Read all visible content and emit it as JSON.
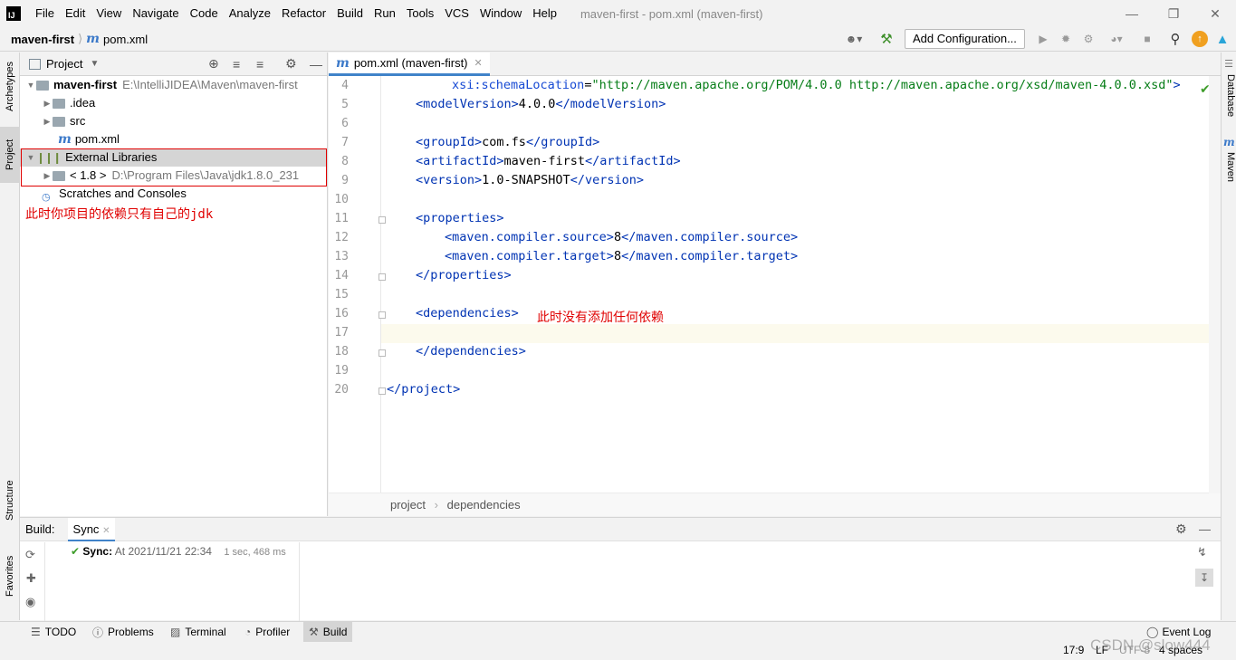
{
  "menubar": {
    "logo": "IJ",
    "items": [
      "File",
      "Edit",
      "View",
      "Navigate",
      "Code",
      "Analyze",
      "Refactor",
      "Build",
      "Run",
      "Tools",
      "VCS",
      "Window",
      "Help"
    ],
    "window_title": "maven-first - pom.xml (maven-first)"
  },
  "navbar": {
    "project": "maven-first",
    "file": "pom.xml",
    "add_configuration": "Add Configuration..."
  },
  "left_stripe": {
    "archetypes": "Archetypes",
    "project": "Project",
    "structure": "Structure",
    "favorites": "Favorites"
  },
  "right_stripe": {
    "database": "Database",
    "maven": "Maven"
  },
  "project_panel": {
    "title": "Project",
    "tree": {
      "root_name": "maven-first",
      "root_path": "E:\\IntelliJIDEA\\Maven\\maven-first",
      "idea": ".idea",
      "src": "src",
      "pom": "pom.xml",
      "ext_libs": "External Libraries",
      "jdk_name": "< 1.8 >",
      "jdk_path": "D:\\Program Files\\Java\\jdk1.8.0_231",
      "scratches": "Scratches and Consoles"
    },
    "annotation": "此时你项目的依赖只有自己的jdk"
  },
  "editor": {
    "tab_label": "pom.xml (maven-first)",
    "lines": {
      "n4": "4",
      "n5": "5",
      "n6": "6",
      "n7": "7",
      "n8": "8",
      "n9": "9",
      "n10": "10",
      "n11": "11",
      "n12": "12",
      "n13": "13",
      "n14": "14",
      "n15": "15",
      "n16": "16",
      "n17": "17",
      "n18": "18",
      "n19": "19",
      "n20": "20"
    },
    "code": {
      "l4_attr": "xsi:schemaLocation",
      "l4_eq": "=",
      "l4_val": "\"http://maven.apache.org/POM/4.0.0 http://maven.apache.org/xsd/maven-4.0.0.xsd\"",
      "l4_end": ">",
      "l5_open": "<modelVersion>",
      "l5_text": "4.0.0",
      "l5_close": "</modelVersion>",
      "l7_open": "<groupId>",
      "l7_text": "com.fs",
      "l7_close": "</groupId>",
      "l8_open": "<artifactId>",
      "l8_text": "maven-first",
      "l8_close": "</artifactId>",
      "l9_open": "<version>",
      "l9_text": "1.0-SNAPSHOT",
      "l9_close": "</version>",
      "l11": "<properties>",
      "l12_open": "<maven.compiler.source>",
      "l12_text": "8",
      "l12_close": "</maven.compiler.source>",
      "l13_open": "<maven.compiler.target>",
      "l13_text": "8",
      "l13_close": "</maven.compiler.target>",
      "l14": "</properties>",
      "l16": "<dependencies>",
      "l18": "</dependencies>",
      "l20": "</project>"
    },
    "annotation": "此时没有添加任何依赖",
    "breadcrumb": {
      "a": "project",
      "b": "dependencies"
    }
  },
  "build_panel": {
    "label": "Build:",
    "tab": "Sync",
    "sync_label": "Sync:",
    "sync_time": "At 2021/11/21 22:34",
    "duration": "1 sec, 468 ms"
  },
  "statusbar": {
    "tabs": [
      "TODO",
      "Problems",
      "Terminal",
      "Profiler",
      "Build"
    ],
    "event_log": "Event Log",
    "position": "17:9",
    "line_sep": "LF",
    "encoding": "UTF-8",
    "indent": "4 spaces",
    "watermark": "CSDN @slow444"
  },
  "colors": {
    "annotation": "#e00000",
    "accent": "#4083c9",
    "tag": "#0033b3",
    "string": "#067d17"
  }
}
